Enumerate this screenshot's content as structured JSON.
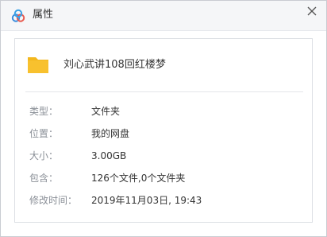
{
  "window": {
    "title": "属性"
  },
  "icons": {
    "app": "baidu-cloud-icon",
    "close": "close-icon",
    "folder": "folder-icon"
  },
  "colors": {
    "folder_yellow": "#f8c12e",
    "app_blue": "#3a8dde"
  },
  "file": {
    "name": "刘心武讲108回红楼梦"
  },
  "properties": [
    {
      "label": "类型：",
      "value": "文件夹"
    },
    {
      "label": "位置：",
      "value": "我的网盘"
    },
    {
      "label": "大小：",
      "value": "3.00GB"
    },
    {
      "label": "包含：",
      "value": "126个文件,0个文件夹"
    },
    {
      "label": "修改时间：",
      "value": "2019年11月03日, 19:43"
    }
  ]
}
